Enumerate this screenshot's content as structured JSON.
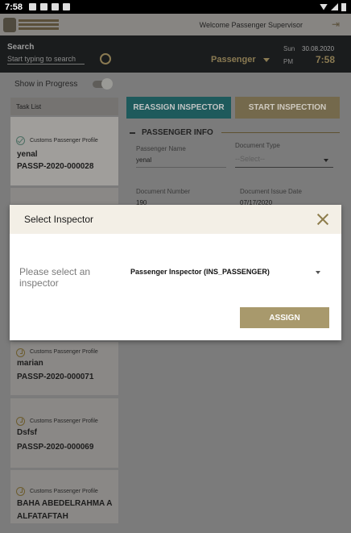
{
  "statusbar": {
    "time": "7:58"
  },
  "header": {
    "welcome": "Welcome Passenger Supervisor"
  },
  "search": {
    "label": "Search",
    "placeholder": "Start typing to search"
  },
  "filter": {
    "selected": "Passenger"
  },
  "datetime": {
    "day": "Sun",
    "date": "30.08.2020",
    "ampm": "PM",
    "time": "7:58"
  },
  "progress_toggle": {
    "label": "Show in Progress",
    "on": true
  },
  "task_list": {
    "header": "Task List",
    "items": [
      {
        "type": "Customs Passenger Profile",
        "name": "yenal",
        "id": "PASSP-2020-000028",
        "status": "checked"
      },
      {
        "type": "Customs Passenger Profile",
        "name": "marian",
        "id": "PASSP-2020-000071",
        "status": "pending"
      },
      {
        "type": "Customs Passenger Profile",
        "name": "Dsfsf",
        "id": "PASSP-2020-000069",
        "status": "pending"
      },
      {
        "type": "Customs Passenger Profile",
        "name": "BAHA ABEDELRAHMA A ALFATAFTAH",
        "id": "",
        "status": "pending"
      }
    ]
  },
  "actions": {
    "reassign": "REASSIGN INSPECTOR",
    "start": "START INSPECTION"
  },
  "passenger_info": {
    "title": "PASSENGER INFO",
    "name_label": "Passenger Name",
    "name_value": "yenal",
    "doctype_label": "Document Type",
    "doctype_placeholder": "--Select--",
    "docnum_label": "Document Number",
    "docnum_value": "190",
    "docdate_label": "Document Issue Date",
    "docdate_value": "07/17/2020"
  },
  "modal": {
    "title": "Select Inspector",
    "prompt": "Please select an inspector",
    "selected_inspector": "Passenger Inspector (INS_PASSENGER)",
    "assign_label": "ASSIGN"
  },
  "colors": {
    "accent": "#a8996c",
    "teal": "#1e5a5c"
  }
}
